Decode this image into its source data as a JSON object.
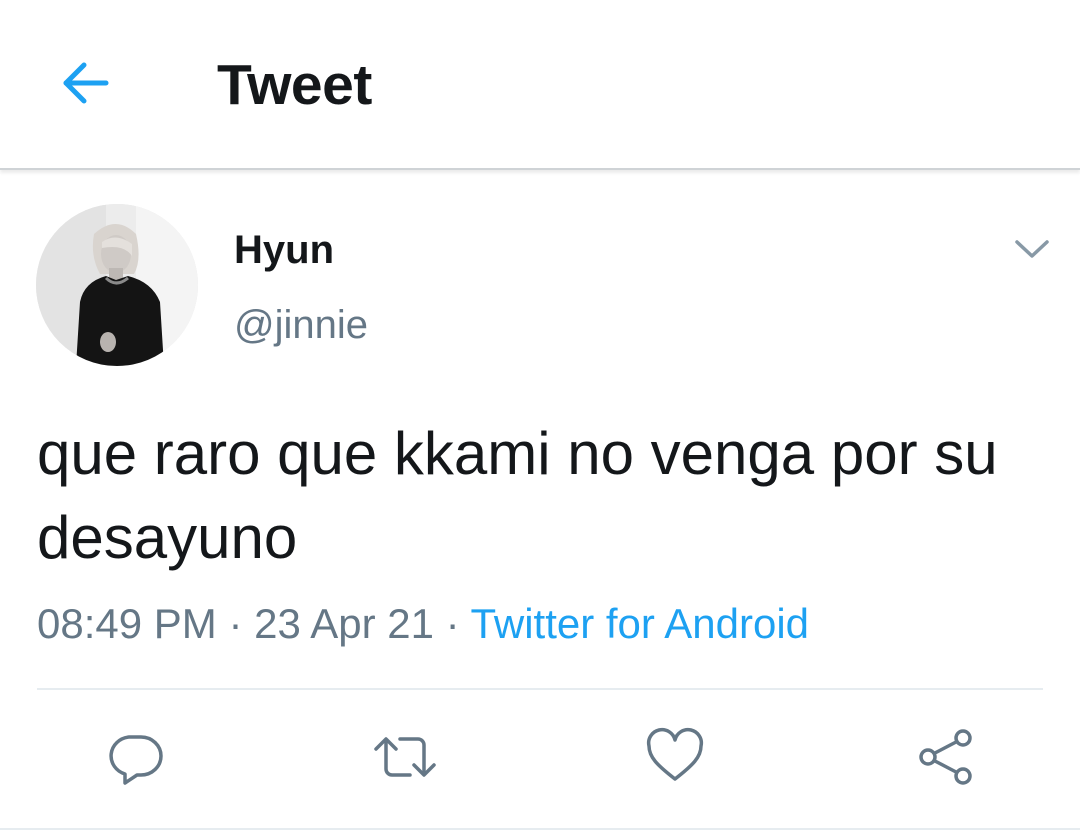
{
  "header": {
    "title": "Tweet",
    "back_icon": "arrow-left-icon",
    "accent_color": "#1da1f2"
  },
  "tweet": {
    "author": {
      "display_name": "Hyun",
      "handle": "@jinnie",
      "avatar": "profile-photo"
    },
    "text": "que raro que kkami no venga por su desayuno",
    "time": "08:49 PM",
    "separator": "·",
    "date": "23 Apr 21",
    "source": "Twitter for Android",
    "menu_icon": "chevron-down-icon"
  },
  "actions": [
    {
      "name": "reply",
      "icon": "reply-icon"
    },
    {
      "name": "retweet",
      "icon": "retweet-icon"
    },
    {
      "name": "like",
      "icon": "heart-icon"
    },
    {
      "name": "share",
      "icon": "share-icon"
    }
  ],
  "colors": {
    "text_primary": "#14171a",
    "text_secondary": "#657786",
    "icon_gray": "#657786",
    "link_blue": "#1da1f2"
  }
}
